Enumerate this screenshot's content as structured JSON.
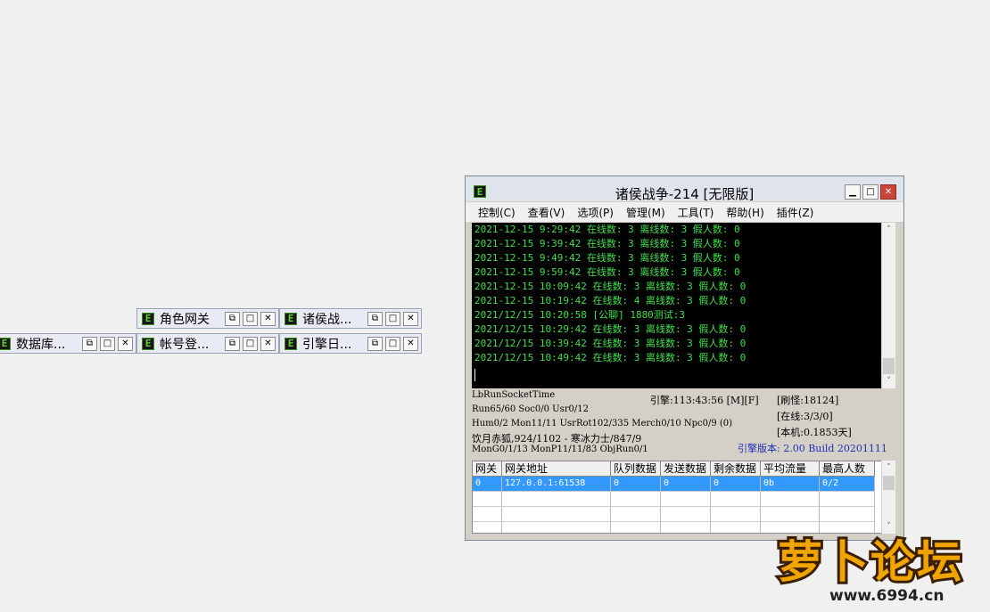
{
  "mini_windows": [
    {
      "title": "角色网关"
    },
    {
      "title": "诸侯战..."
    },
    {
      "title": "数据库..."
    },
    {
      "title": "帐号登..."
    },
    {
      "title": "引擎日..."
    }
  ],
  "main_window": {
    "title": "诸侯战争-214 [无限版]",
    "menu": [
      "控制(C)",
      "查看(V)",
      "选项(P)",
      "管理(M)",
      "工具(T)",
      "帮助(H)",
      "插件(Z)"
    ]
  },
  "console_lines": [
    "2021-12-15 9:29:42 在线数: 3 离线数: 3 假人数: 0",
    "2021-12-15 9:39:42 在线数: 3 离线数: 3 假人数: 0",
    "2021-12-15 9:49:42 在线数: 3 离线数: 3 假人数: 0",
    "2021-12-15 9:59:42 在线数: 3 离线数: 3 假人数: 0",
    "2021-12-15 10:09:42 在线数: 3 离线数: 3 假人数: 0",
    "2021-12-15 10:19:42 在线数: 4 离线数: 3 假人数: 0",
    "2021/12/15 10:20:58 [公聊] 1880测试:3",
    "2021/12/15 10:29:42 在线数: 3 离线数: 3 假人数: 0",
    "2021/12/15 10:39:42 在线数: 3 离线数: 3 假人数: 0",
    "2021/12/15 10:49:42 在线数: 3 离线数: 3 假人数: 0"
  ],
  "status": {
    "socket_time": "LbRunSocketTime",
    "engine_time": "引擎:113:43:56 [M][F]",
    "refresh": "[刷怪:18124]",
    "run": "Run65/60 Soc0/0 Usr0/12",
    "online": "[在线:3/3/0]",
    "hum": "Hum0/2 Mon11/11 UsrRot102/335 Merch0/10 Npc0/9 (0)",
    "local": "[本机:0.1853天]",
    "boss": "饮月赤狐,924/1102 - 寒冰力士/847/9",
    "version": "引擎版本: 2.00 Build 20201111",
    "mon": "MonG0/1/13 MonP11/11/83 ObjRun0/1"
  },
  "gateway_table": {
    "headers": [
      "网关",
      "网关地址",
      "队列数据",
      "发送数据",
      "剩余数据",
      "平均流量",
      "最高人数"
    ],
    "rows": [
      [
        "0",
        "127.0.0.1:61538",
        "0",
        "0",
        "0",
        "0b",
        "0/2"
      ]
    ]
  },
  "watermark": {
    "brand": "萝卜论坛",
    "domain": "www.6994.cn"
  },
  "colors": {
    "console_text": "#3fe04a",
    "console_bg": "#000000",
    "selection": "#3399ff",
    "version_text": "#1f2fb5"
  }
}
